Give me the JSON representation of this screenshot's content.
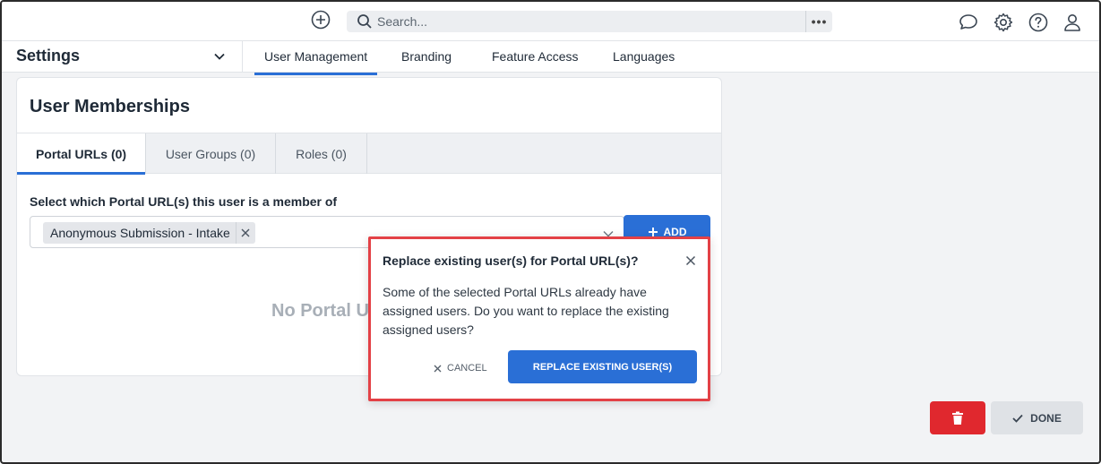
{
  "topbar": {
    "search_placeholder": "Search...",
    "more_label": "•••"
  },
  "subnav": {
    "title": "Settings",
    "tabs": [
      {
        "label": "User Management",
        "active": true
      },
      {
        "label": "Branding",
        "active": false
      },
      {
        "label": "Feature Access",
        "active": false
      },
      {
        "label": "Languages",
        "active": false
      }
    ]
  },
  "card": {
    "title": "User Memberships",
    "tabs": [
      {
        "label": "Portal URLs (0)",
        "active": true
      },
      {
        "label": "User Groups (0)",
        "active": false
      },
      {
        "label": "Roles (0)",
        "active": false
      }
    ],
    "select_label": "Select which Portal URL(s) this user is a member of",
    "selected_chip": "Anonymous Submission - Intake",
    "add_label": "ADD",
    "empty_text": "No Portal U"
  },
  "actions": {
    "done_label": "DONE"
  },
  "modal": {
    "title": "Replace existing user(s) for Portal URL(s)?",
    "body": "Some of the selected Portal URLs already have assigned users. Do you want to replace the existing assigned users?",
    "cancel_label": "CANCEL",
    "confirm_label": "REPLACE EXISTING USER(S)"
  },
  "colors": {
    "accent": "#2a6fd6",
    "danger": "#e0282e",
    "highlight": "#e34146"
  }
}
